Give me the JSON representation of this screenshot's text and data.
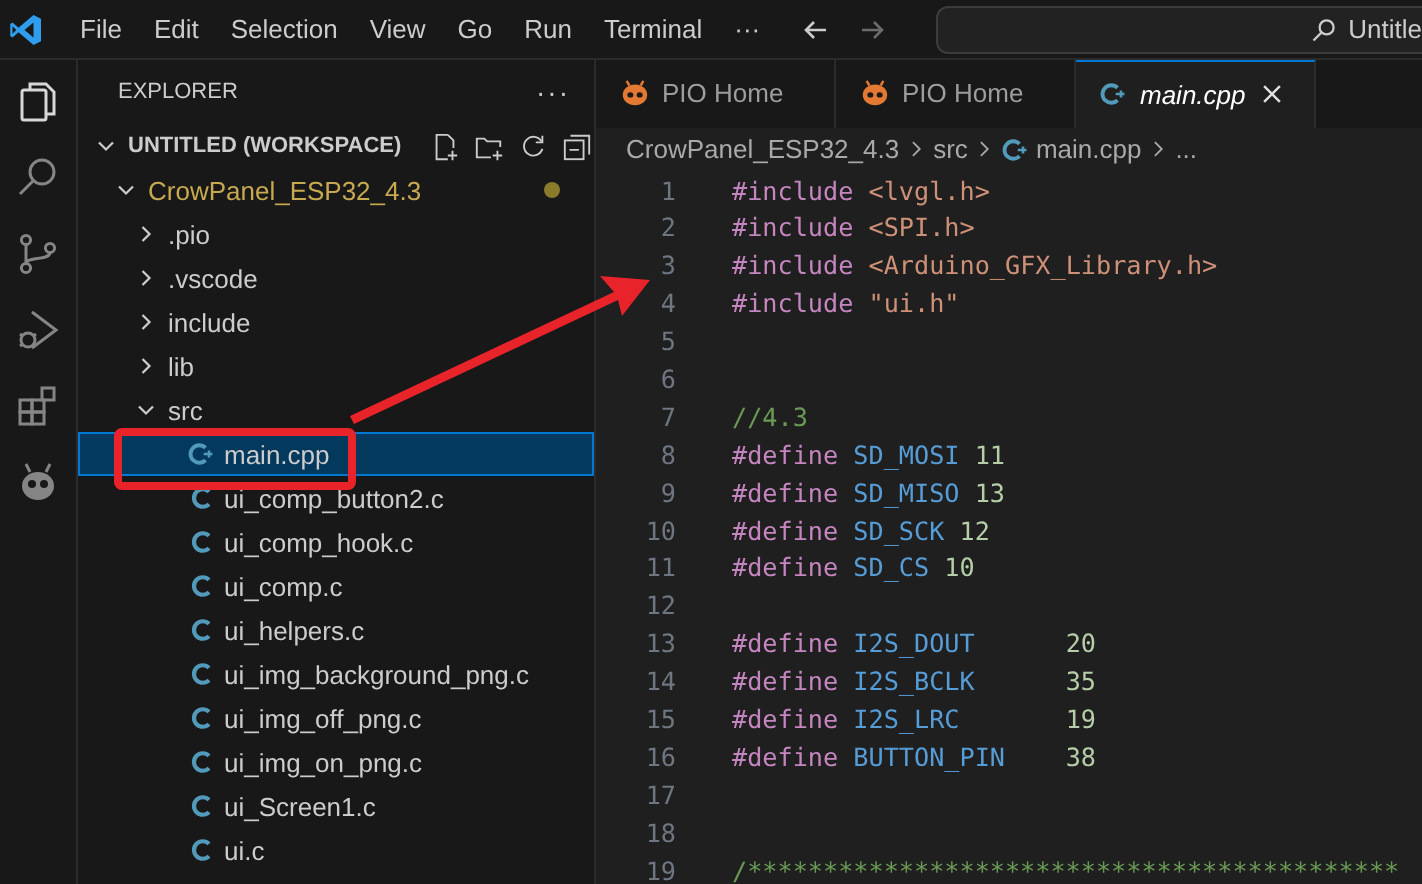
{
  "menu": [
    "File",
    "Edit",
    "Selection",
    "View",
    "Go",
    "Run",
    "Terminal"
  ],
  "menu_overflow": "···",
  "search": {
    "value": "Untitle"
  },
  "activity_bar": [
    {
      "kind": "explorer",
      "selected": true
    },
    {
      "kind": "search",
      "selected": false
    },
    {
      "kind": "source-control",
      "selected": false
    },
    {
      "kind": "run-debug",
      "selected": false
    },
    {
      "kind": "extensions",
      "selected": false
    },
    {
      "kind": "platformio",
      "selected": false
    }
  ],
  "sidebar": {
    "title": "EXPLORER",
    "more": "···",
    "tree": [
      {
        "label": "UNTITLED (WORKSPACE)",
        "kind": "workspace",
        "expanded": true,
        "selected": false,
        "children": [
          {
            "label": "CrowPanel_ESP32_4.3",
            "kind": "folder",
            "expanded": true,
            "modified": true,
            "selected": false,
            "children": [
              {
                "label": ".pio",
                "kind": "folder",
                "expanded": false,
                "selected": false
              },
              {
                "label": ".vscode",
                "kind": "folder",
                "expanded": false,
                "selected": false
              },
              {
                "label": "include",
                "kind": "folder",
                "expanded": false,
                "selected": false
              },
              {
                "label": "lib",
                "kind": "folder",
                "expanded": false,
                "selected": false
              },
              {
                "label": "src",
                "kind": "folder",
                "expanded": true,
                "selected": false,
                "children": [
                  {
                    "label": "main.cpp",
                    "kind": "cpp",
                    "selected": true
                  },
                  {
                    "label": "ui_comp_button2.c",
                    "kind": "c",
                    "selected": false
                  },
                  {
                    "label": "ui_comp_hook.c",
                    "kind": "c",
                    "selected": false
                  },
                  {
                    "label": "ui_comp.c",
                    "kind": "c",
                    "selected": false
                  },
                  {
                    "label": "ui_helpers.c",
                    "kind": "c",
                    "selected": false
                  },
                  {
                    "label": "ui_img_background_png.c",
                    "kind": "c",
                    "selected": false
                  },
                  {
                    "label": "ui_img_off_png.c",
                    "kind": "c",
                    "selected": false
                  },
                  {
                    "label": "ui_img_on_png.c",
                    "kind": "c",
                    "selected": false
                  },
                  {
                    "label": "ui_Screen1.c",
                    "kind": "c",
                    "selected": false
                  },
                  {
                    "label": "ui.c",
                    "kind": "c",
                    "selected": false
                  }
                ]
              }
            ]
          }
        ]
      }
    ]
  },
  "tabs": [
    {
      "label": "PIO Home",
      "kind": "pio",
      "selected": false,
      "preview": false
    },
    {
      "label": "PIO Home",
      "kind": "pio",
      "selected": false,
      "preview": false
    },
    {
      "label": "main.cpp",
      "kind": "cpp",
      "selected": true,
      "preview": true
    }
  ],
  "breadcrumb": [
    {
      "label": "CrowPanel_ESP32_4.3",
      "kind": "folder"
    },
    {
      "label": "src",
      "kind": "folder"
    },
    {
      "label": "main.cpp",
      "kind": "cpp"
    },
    {
      "label": "...",
      "kind": "more"
    }
  ],
  "code": [
    {
      "number": "1",
      "tokens": [
        {
          "text": "#include ",
          "kind": "keyword"
        },
        {
          "text": "<lvgl.h>",
          "kind": "string"
        }
      ]
    },
    {
      "number": "2",
      "tokens": [
        {
          "text": "#include ",
          "kind": "keyword"
        },
        {
          "text": "<SPI.h>",
          "kind": "string"
        }
      ]
    },
    {
      "number": "3",
      "tokens": [
        {
          "text": "#include ",
          "kind": "keyword"
        },
        {
          "text": "<Arduino_GFX_Library.h>",
          "kind": "string"
        }
      ]
    },
    {
      "number": "4",
      "tokens": [
        {
          "text": "#include ",
          "kind": "keyword"
        },
        {
          "text": "\"ui.h\"",
          "kind": "string"
        }
      ]
    },
    {
      "number": "5"
    },
    {
      "number": "6"
    },
    {
      "number": "7",
      "tokens": [
        {
          "text": "//4.3",
          "kind": "comment"
        }
      ]
    },
    {
      "number": "8",
      "tokens": [
        {
          "text": "#define ",
          "kind": "keyword"
        },
        {
          "text": "SD_MOSI ",
          "kind": "macro"
        },
        {
          "text": "11",
          "kind": "number"
        }
      ]
    },
    {
      "number": "9",
      "tokens": [
        {
          "text": "#define ",
          "kind": "keyword"
        },
        {
          "text": "SD_MISO ",
          "kind": "macro"
        },
        {
          "text": "13",
          "kind": "number"
        }
      ]
    },
    {
      "number": "10",
      "tokens": [
        {
          "text": "#define ",
          "kind": "keyword"
        },
        {
          "text": "SD_SCK ",
          "kind": "macro"
        },
        {
          "text": "12",
          "kind": "number"
        }
      ]
    },
    {
      "number": "11",
      "tokens": [
        {
          "text": "#define ",
          "kind": "keyword"
        },
        {
          "text": "SD_CS ",
          "kind": "macro"
        },
        {
          "text": "10",
          "kind": "number"
        }
      ]
    },
    {
      "number": "12"
    },
    {
      "number": "13",
      "tokens": [
        {
          "text": "#define ",
          "kind": "keyword"
        },
        {
          "text": "I2S_DOUT      ",
          "kind": "macro"
        },
        {
          "text": "20",
          "kind": "number"
        }
      ]
    },
    {
      "number": "14",
      "tokens": [
        {
          "text": "#define ",
          "kind": "keyword"
        },
        {
          "text": "I2S_BCLK      ",
          "kind": "macro"
        },
        {
          "text": "35",
          "kind": "number"
        }
      ]
    },
    {
      "number": "15",
      "tokens": [
        {
          "text": "#define ",
          "kind": "keyword"
        },
        {
          "text": "I2S_LRC       ",
          "kind": "macro"
        },
        {
          "text": "19",
          "kind": "number"
        }
      ]
    },
    {
      "number": "16",
      "tokens": [
        {
          "text": "#define ",
          "kind": "keyword"
        },
        {
          "text": "BUTTON_PIN    ",
          "kind": "macro"
        },
        {
          "text": "38",
          "kind": "number"
        }
      ]
    },
    {
      "number": "17"
    },
    {
      "number": "18"
    },
    {
      "number": "19",
      "tokens": [
        {
          "text": "/*******************************************",
          "kind": "comment"
        }
      ]
    }
  ]
}
